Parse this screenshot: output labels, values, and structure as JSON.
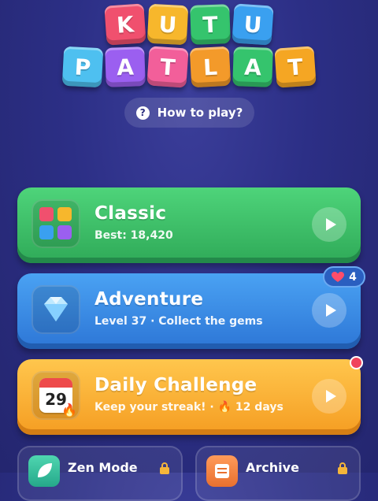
{
  "logo": {
    "row1": [
      "K",
      "U",
      "T",
      "U"
    ],
    "row2": [
      "P",
      "A",
      "T",
      "L",
      "A",
      "T"
    ],
    "row1_colors": [
      "#f0506e",
      "#f7b72c",
      "#35c46d",
      "#3aa0f0"
    ],
    "row2_colors": [
      "#4ec0f0",
      "#9b5ff0",
      "#f25f9a",
      "#f39a2a",
      "#35c46d",
      "#f5a623"
    ]
  },
  "how_to_play": {
    "label": "How to play?",
    "icon": "question-icon"
  },
  "modes": [
    {
      "title": "Classic",
      "subtitle": "Best: 18,420",
      "icon": "blocks-icon",
      "color": "#35c46d"
    },
    {
      "title": "Adventure",
      "subtitle": "Level 37 · Collect the gems",
      "icon": "diamond-icon",
      "color": "#3b8ee8"
    },
    {
      "title": "Daily Challenge",
      "subtitle_prefix": "Keep your streak! · ",
      "subtitle_suffix": " 12 days",
      "icon": "calendar-icon",
      "calendar_day": "29",
      "color": "#f7b03a"
    }
  ],
  "adventure_badge": {
    "count": "4",
    "icon": "heart-icon"
  },
  "bottom": [
    {
      "label": "Zen Mode",
      "icon": "leaf-icon"
    },
    {
      "label": "Archive",
      "icon": "archive-icon"
    }
  ]
}
